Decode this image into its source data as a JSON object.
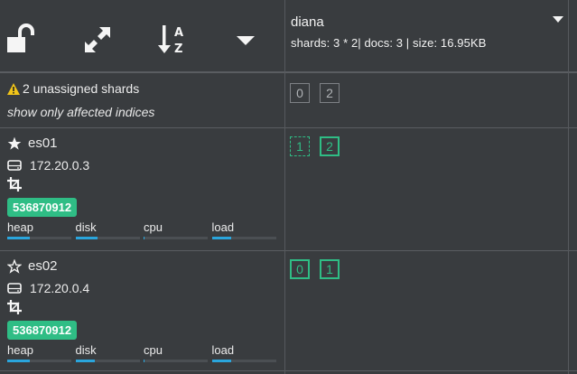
{
  "toolbar": {
    "icons": [
      "unlock-icon",
      "expand-icon",
      "sort-alpha-icon",
      "caret-down-icon"
    ]
  },
  "index": {
    "name": "diana",
    "meta": "shards: 3 * 2| docs: 3 | size: 16.95KB"
  },
  "unassigned": {
    "text": "2 unassigned shards",
    "filter_link": "show only affected indices",
    "shards": [
      "0",
      "2"
    ]
  },
  "nodes": [
    {
      "name": "es01",
      "master": true,
      "ip": "172.20.0.3",
      "badge": "536870912",
      "metrics": [
        {
          "label": "heap",
          "level": 0.35
        },
        {
          "label": "disk",
          "level": 0.35
        },
        {
          "label": "cpu",
          "level": 0.02
        },
        {
          "label": "load",
          "level": 0.3
        }
      ],
      "shards": [
        "1",
        "2"
      ]
    },
    {
      "name": "es02",
      "master": false,
      "ip": "172.20.0.4",
      "badge": "536870912",
      "metrics": [
        {
          "label": "heap",
          "level": 0.35
        },
        {
          "label": "disk",
          "level": 0.3
        },
        {
          "label": "cpu",
          "level": 0.02
        },
        {
          "label": "load",
          "level": 0.3
        }
      ],
      "shards": [
        "0",
        "1"
      ]
    }
  ],
  "colors": {
    "background": "#393c3f",
    "accent_green": "#2fbd85",
    "metric_blue": "#2aa5dc",
    "warning_yellow": "#f0c419"
  }
}
